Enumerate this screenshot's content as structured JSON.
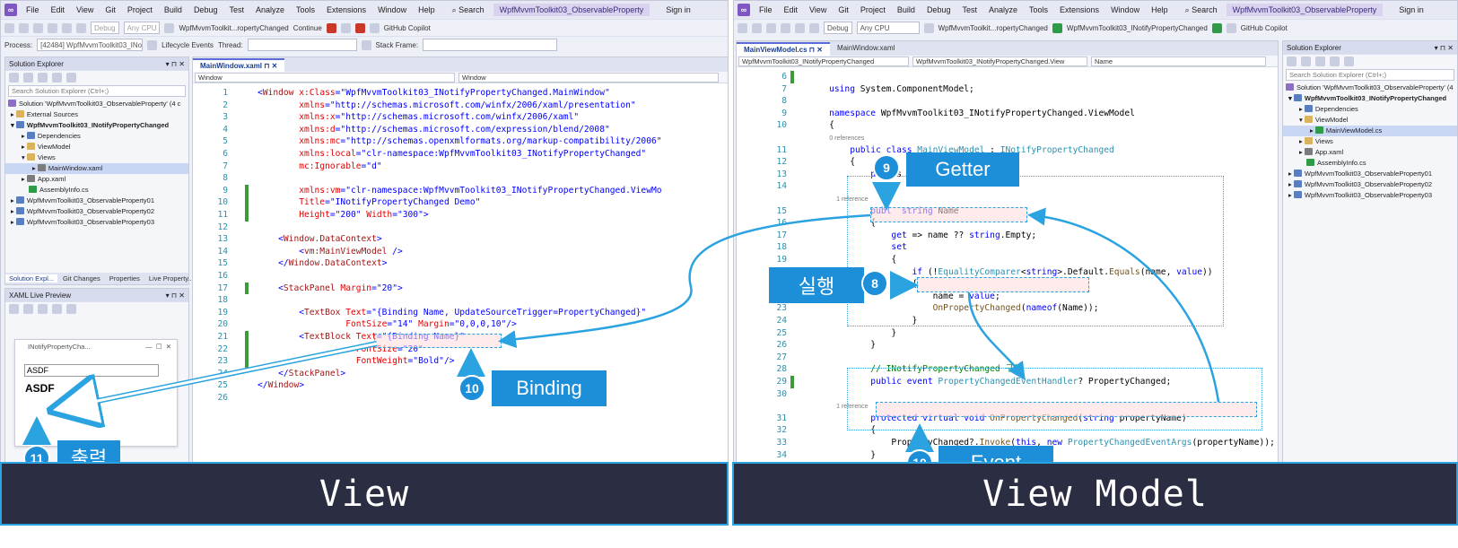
{
  "left_window": {
    "menu": [
      "File",
      "Edit",
      "View",
      "Git",
      "Project",
      "Build",
      "Debug",
      "Test",
      "Analyze",
      "Tools",
      "Extensions",
      "Window",
      "Help"
    ],
    "search": "Search",
    "title": "WpfMvvmToolkit03_ObservableProperty",
    "sign_in": "Sign in",
    "toolbar": {
      "config": "Debug",
      "platform": "Any CPU",
      "startup": "WpfMvvmToolkit...ropertyChanged",
      "continue": "Continue",
      "copilot": "GitHub Copilot"
    },
    "process_bar": {
      "process_label": "Process:",
      "process_value": "[42484] WpfMvvmToolkit03_INotif",
      "lifecycle": "Lifecycle Events",
      "thread": "Thread:",
      "stack_frame": "Stack Frame:"
    },
    "solution_explorer": {
      "header": "Solution Explorer",
      "search_placeholder": "Search Solution Explorer (Ctrl+;)",
      "items": [
        "Solution 'WpfMvvmToolkit03_ObservableProperty' (4 c",
        "External Sources",
        "WpfMvvmToolkit03_INotifyPropertyChanged",
        "Dependencies",
        "ViewModel",
        "Views",
        "MainWindow.xaml",
        "App.xaml",
        "AssemblyInfo.cs",
        "WpfMvvmToolkit03_ObservableProperty01",
        "WpfMvvmToolkit03_ObservableProperty02",
        "WpfMvvmToolkit03_ObservableProperty03"
      ],
      "bottom_tabs": [
        "Solution Expl...",
        "Git Changes",
        "Properties",
        "Live Property..."
      ]
    },
    "xaml_live_preview": {
      "header": "XAML Live Preview",
      "window_title": "INotifyPropertyCha...",
      "textbox_value": "ASDF",
      "textblock_value": "ASDF"
    },
    "editor": {
      "tab": "MainWindow.xaml",
      "nav_left": "Window",
      "nav_right": "Window",
      "lines": [
        {
          "n": "1",
          "parts": [
            [
              "k-val",
              "<"
            ],
            [
              "k-tag",
              "Window"
            ],
            [
              "k-attr",
              " x:Class"
            ],
            [
              "k-val",
              "=\"WpfMvvmToolkit03_INotifyPropertyChanged.MainWindow\""
            ]
          ]
        },
        {
          "n": "2",
          "parts": [
            [
              "k-attr",
              "        xmlns"
            ],
            [
              "k-val",
              "=\"http://schemas.microsoft.com/winfx/2006/xaml/presentation\""
            ]
          ]
        },
        {
          "n": "3",
          "parts": [
            [
              "k-attr",
              "        xmlns:x"
            ],
            [
              "k-val",
              "=\"http://schemas.microsoft.com/winfx/2006/xaml\""
            ]
          ]
        },
        {
          "n": "4",
          "parts": [
            [
              "k-attr",
              "        xmlns:d"
            ],
            [
              "k-val",
              "=\"http://schemas.microsoft.com/expression/blend/2008\""
            ]
          ]
        },
        {
          "n": "5",
          "parts": [
            [
              "k-attr",
              "        xmlns:mc"
            ],
            [
              "k-val",
              "=\"http://schemas.openxmlformats.org/markup-compatibility/2006\""
            ]
          ]
        },
        {
          "n": "6",
          "parts": [
            [
              "k-attr",
              "        xmlns:local"
            ],
            [
              "k-val",
              "=\"clr-namespace:WpfMvvmToolkit03_INotifyPropertyChanged\""
            ]
          ]
        },
        {
          "n": "7",
          "parts": [
            [
              "k-attr",
              "        mc:Ignorable"
            ],
            [
              "k-val",
              "=\"d\""
            ]
          ]
        },
        {
          "n": "8",
          "parts": []
        },
        {
          "n": "9",
          "parts": [
            [
              "k-attr",
              "        xmlns:vm"
            ],
            [
              "k-val",
              "=\"clr-namespace:WpfMvvmToolkit03_INotifyPropertyChanged.ViewMo"
            ]
          ]
        },
        {
          "n": "10",
          "parts": [
            [
              "k-attr",
              "        Title"
            ],
            [
              "k-val",
              "=\"INotifyPropertyChanged Demo\""
            ]
          ]
        },
        {
          "n": "11",
          "parts": [
            [
              "k-attr",
              "        Height"
            ],
            [
              "k-val",
              "=\"200\""
            ],
            [
              "k-attr",
              " Width"
            ],
            [
              "k-val",
              "=\"300\">"
            ]
          ]
        },
        {
          "n": "12",
          "parts": []
        },
        {
          "n": "13",
          "parts": [
            [
              "k-val",
              "    <"
            ],
            [
              "k-tag",
              "Window.DataContext"
            ],
            [
              "k-val",
              ">"
            ]
          ]
        },
        {
          "n": "14",
          "parts": [
            [
              "k-val",
              "        <"
            ],
            [
              "k-tag",
              "vm:MainViewModel"
            ],
            [
              "k-val",
              " />"
            ]
          ]
        },
        {
          "n": "15",
          "parts": [
            [
              "k-val",
              "    </"
            ],
            [
              "k-tag",
              "Window.DataContext"
            ],
            [
              "k-val",
              ">"
            ]
          ]
        },
        {
          "n": "16",
          "parts": []
        },
        {
          "n": "17",
          "parts": [
            [
              "k-val",
              "    <"
            ],
            [
              "k-tag",
              "StackPanel"
            ],
            [
              "k-attr",
              " Margin"
            ],
            [
              "k-val",
              "=\"20\">"
            ]
          ]
        },
        {
          "n": "18",
          "parts": []
        },
        {
          "n": "19",
          "parts": [
            [
              "k-val",
              "        <"
            ],
            [
              "k-tag",
              "TextBox"
            ],
            [
              "k-attr",
              " Text"
            ],
            [
              "k-val",
              "=\"{Binding Name, UpdateSourceTrigger=PropertyChanged}\""
            ]
          ]
        },
        {
          "n": "20",
          "parts": [
            [
              "k-attr",
              "                 FontSize"
            ],
            [
              "k-val",
              "=\"14\""
            ],
            [
              "k-attr",
              " Margin"
            ],
            [
              "k-val",
              "=\"0,0,0,10\"/>"
            ]
          ]
        },
        {
          "n": "21",
          "parts": [
            [
              "k-val",
              "        <"
            ],
            [
              "k-tag",
              "TextBlock"
            ],
            [
              "k-attr",
              " Text"
            ],
            [
              "k-val",
              "=\"{Binding Name}\""
            ]
          ]
        },
        {
          "n": "22",
          "parts": [
            [
              "k-attr",
              "                   FontSize"
            ],
            [
              "k-val",
              "=\"20\""
            ]
          ]
        },
        {
          "n": "23",
          "parts": [
            [
              "k-attr",
              "                   FontWeight"
            ],
            [
              "k-val",
              "=\"Bold\"/>"
            ]
          ]
        },
        {
          "n": "24",
          "parts": [
            [
              "k-val",
              "    </"
            ],
            [
              "k-tag",
              "StackPanel"
            ],
            [
              "k-val",
              ">"
            ]
          ]
        },
        {
          "n": "25",
          "parts": [
            [
              "k-val",
              "</"
            ],
            [
              "k-tag",
              "Window"
            ],
            [
              "k-val",
              ">"
            ]
          ]
        },
        {
          "n": "26",
          "parts": []
        }
      ]
    }
  },
  "right_window": {
    "menu": [
      "File",
      "Edit",
      "View",
      "Git",
      "Project",
      "Build",
      "Debug",
      "Test",
      "Analyze",
      "Tools",
      "Extensions",
      "Window",
      "Help"
    ],
    "search": "Search",
    "title": "WpfMvvmToolkit03_ObservableProperty",
    "sign_in": "Sign in",
    "toolbar": {
      "config": "Debug",
      "platform": "Any CPU",
      "startup": "WpfMvvmToolkit...ropertyChanged",
      "run_target": "WpfMvvmToolkit03_INotifyPropertyChanged",
      "copilot": "GitHub Copilot"
    },
    "editor": {
      "tabs": [
        "MainViewModel.cs",
        "MainWindow.xaml"
      ],
      "nav": [
        "WpfMvvmToolkit03_INotifyPropertyChanged",
        "WpfMvvmToolkit03_INotifyPropertyChanged.View",
        "Name"
      ],
      "lines": [
        {
          "n": "6",
          "parts": []
        },
        {
          "n": "7",
          "parts": [
            [
              "k-kw",
              "    using"
            ],
            [
              "k-blk",
              " System.ComponentModel;"
            ]
          ]
        },
        {
          "n": "8",
          "parts": []
        },
        {
          "n": "9",
          "parts": [
            [
              "k-kw",
              "    namespace"
            ],
            [
              "k-blk",
              " WpfMvvmToolkit03_INotifyPropertyChanged.ViewModel"
            ]
          ]
        },
        {
          "n": "10",
          "parts": [
            [
              "k-blk",
              "    {"
            ]
          ]
        },
        {
          "n": "",
          "parts": [
            [
              "k-ref",
              "            0 references"
            ]
          ]
        },
        {
          "n": "11",
          "parts": [
            [
              "k-kw",
              "        public class"
            ],
            [
              "k-type",
              " MainViewModel"
            ],
            [
              "k-blk",
              " : "
            ],
            [
              "k-type",
              "INotifyPropertyChanged"
            ]
          ]
        },
        {
          "n": "12",
          "parts": [
            [
              "k-blk",
              "        {"
            ]
          ]
        },
        {
          "n": "13",
          "parts": [
            [
              "k-kw",
              "            pri"
            ],
            [
              "k-blk",
              "  s"
            ]
          ]
        },
        {
          "n": "14",
          "parts": []
        },
        {
          "n": "",
          "parts": [
            [
              "k-ref",
              "                1 reference"
            ]
          ]
        },
        {
          "n": "15",
          "parts": [
            [
              "k-kw",
              "            publ"
            ],
            [
              "k-kw",
              "  string"
            ],
            [
              "k-blk",
              " Name"
            ]
          ]
        },
        {
          "n": "16",
          "parts": [
            [
              "k-blk",
              "            {"
            ]
          ]
        },
        {
          "n": "17",
          "parts": [
            [
              "k-kw",
              "                get"
            ],
            [
              "k-blk",
              " => name ?? "
            ],
            [
              "k-kw",
              "string"
            ],
            [
              "k-blk",
              ".Empty;"
            ]
          ]
        },
        {
          "n": "18",
          "parts": [
            [
              "k-kw",
              "                set"
            ]
          ]
        },
        {
          "n": "19",
          "parts": [
            [
              "k-blk",
              "                {"
            ]
          ]
        },
        {
          "n": "20",
          "parts": [
            [
              "k-kw",
              "                    if"
            ],
            [
              "k-blk",
              " (!"
            ],
            [
              "k-type",
              "EqualityComparer"
            ],
            [
              "k-blk",
              "<"
            ],
            [
              "k-kw",
              "string"
            ],
            [
              "k-blk",
              ">.Default."
            ],
            [
              "k-method",
              "Equals"
            ],
            [
              "k-blk",
              "(name, "
            ],
            [
              "k-kw",
              "value"
            ],
            [
              "k-blk",
              "))"
            ]
          ]
        },
        {
          "n": "21",
          "parts": [
            [
              "k-blk",
              "                    {"
            ]
          ]
        },
        {
          "n": "22",
          "parts": [
            [
              "k-blk",
              "                        name = "
            ],
            [
              "k-kw",
              "value"
            ],
            [
              "k-blk",
              ";"
            ]
          ]
        },
        {
          "n": "23",
          "parts": [
            [
              "k-method",
              "                        OnPropertyChanged"
            ],
            [
              "k-blk",
              "("
            ],
            [
              "k-kw",
              "nameof"
            ],
            [
              "k-blk",
              "(Name));"
            ]
          ]
        },
        {
          "n": "24",
          "parts": [
            [
              "k-blk",
              "                    }"
            ]
          ]
        },
        {
          "n": "25",
          "parts": [
            [
              "k-blk",
              "                }"
            ]
          ]
        },
        {
          "n": "26",
          "parts": [
            [
              "k-blk",
              "            }"
            ]
          ]
        },
        {
          "n": "27",
          "parts": []
        },
        {
          "n": "28",
          "parts": [
            [
              "k-cm",
              "            // INotifyPropertyChanged 구현"
            ]
          ]
        },
        {
          "n": "29",
          "parts": [
            [
              "k-kw",
              "            public event"
            ],
            [
              "k-type",
              " PropertyChangedEventHandler"
            ],
            [
              "k-blk",
              "? PropertyChanged;"
            ]
          ]
        },
        {
          "n": "30",
          "parts": []
        },
        {
          "n": "",
          "parts": [
            [
              "k-ref",
              "                1 reference"
            ]
          ]
        },
        {
          "n": "31",
          "parts": [
            [
              "k-kw",
              "            protected virtual void"
            ],
            [
              "k-method",
              " OnPropertyChanged"
            ],
            [
              "k-blk",
              "("
            ],
            [
              "k-kw",
              "string"
            ],
            [
              "k-blk",
              " propertyName)"
            ]
          ]
        },
        {
          "n": "32",
          "parts": [
            [
              "k-blk",
              "            {"
            ]
          ]
        },
        {
          "n": "33",
          "parts": [
            [
              "k-blk",
              "                PropertyChanged?."
            ],
            [
              "k-method",
              "Invoke"
            ],
            [
              "k-blk",
              "("
            ],
            [
              "k-kw",
              "this"
            ],
            [
              "k-blk",
              ", "
            ],
            [
              "k-kw",
              "new"
            ],
            [
              "k-type",
              " PropertyChangedEventArgs"
            ],
            [
              "k-blk",
              "(propertyName));"
            ]
          ]
        },
        {
          "n": "34",
          "parts": [
            [
              "k-blk",
              "            }"
            ]
          ]
        },
        {
          "n": "35",
          "parts": [
            [
              "k-blk",
              "        }"
            ]
          ]
        },
        {
          "n": "36",
          "parts": [
            [
              "k-blk",
              "    }"
            ]
          ]
        },
        {
          "n": "37",
          "parts": []
        }
      ]
    },
    "solution_explorer": {
      "header": "Solution Explorer",
      "search_placeholder": "Search Solution Explorer (Ctrl+;)",
      "items": [
        "Solution 'WpfMvvmToolkit03_ObservableProperty' (4",
        "WpfMvvmToolkit03_INotifyPropertyChanged",
        "Dependencies",
        "ViewModel",
        "MainViewModel.cs",
        "Views",
        "App.xaml",
        "AssemblyInfo.cs",
        "WpfMvvmToolkit03_ObservableProperty01",
        "WpfMvvmToolkit03_ObservableProperty02",
        "WpfMvvmToolkit03_ObservableProperty03"
      ]
    }
  },
  "annotations": {
    "getter": {
      "number": "9",
      "label": "Getter"
    },
    "execute": {
      "number": "8",
      "label": "실행"
    },
    "binding": {
      "number": "10",
      "label": "Binding"
    },
    "event": {
      "number": "10",
      "label": "Event"
    },
    "output": {
      "number": "11",
      "label": "출력"
    }
  },
  "captions": {
    "view": "View",
    "view_model": "View Model"
  },
  "colors": {
    "accent": "#1d8fd8",
    "caption_bg": "#2b2d42",
    "arrow": "#2aa3e0"
  }
}
